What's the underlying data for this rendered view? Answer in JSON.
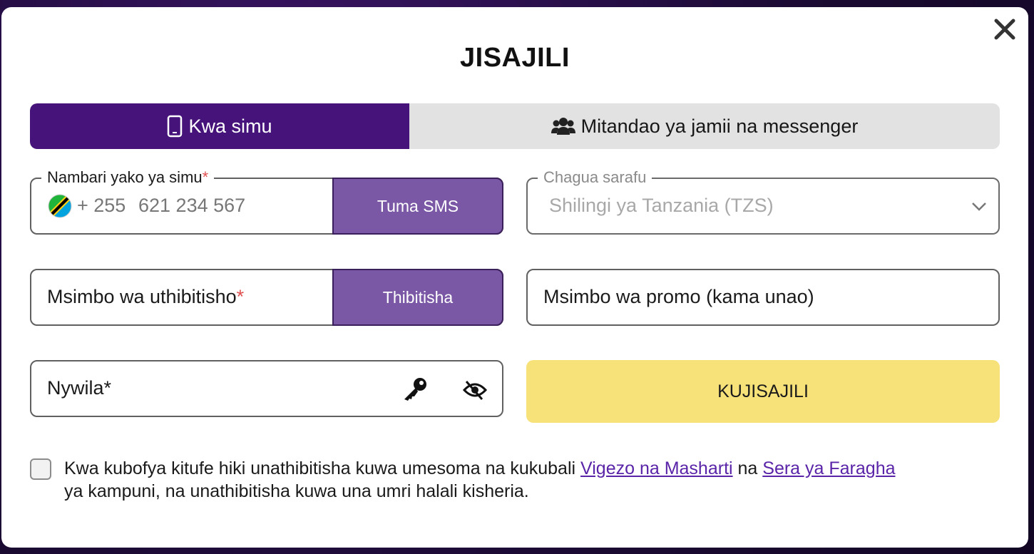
{
  "modal": {
    "title": "JISAJILI",
    "close_icon": "close-icon"
  },
  "tabs": [
    {
      "label": "Kwa simu",
      "icon": "phone-icon",
      "active": true
    },
    {
      "label": "Mitandao ya jamii na messenger",
      "icon": "users-icon",
      "active": false
    }
  ],
  "phone": {
    "label": "Nambari yako ya simu",
    "required_mark": "*",
    "country_code": "+ 255",
    "placeholder": "621 234 567",
    "flag_icon": "tanzania-flag-icon",
    "button_label": "Tuma SMS"
  },
  "currency": {
    "label": "Chagua sarafu",
    "value": "Shilingi ya Tanzania (TZS)",
    "chevron_icon": "chevron-down-icon"
  },
  "verification": {
    "placeholder": "Msimbo wa uthibitisho",
    "required_mark": "*",
    "button_label": "Thibitisha"
  },
  "promo": {
    "placeholder": "Msimbo wa promo (kama unao)"
  },
  "password": {
    "placeholder": "Nywila*",
    "key_icon": "key-icon",
    "eye_icon": "eye-slash-icon"
  },
  "submit": {
    "label": "KUJISAJILI"
  },
  "terms": {
    "text_before": "Kwa kubofya kitufe hiki unathibitisha kuwa umesoma na kukubali ",
    "link1": "Vigezo na Masharti",
    "text_middle": " na ",
    "link2": "Sera ya Faragha",
    "text_after": " ya kampuni, na unathibitisha kuwa una umri halali kisheria."
  },
  "colors": {
    "accent_purple": "#45137a",
    "button_purple": "#7a58a6",
    "submit_yellow": "#f7e27a",
    "link": "#5a24a8"
  }
}
